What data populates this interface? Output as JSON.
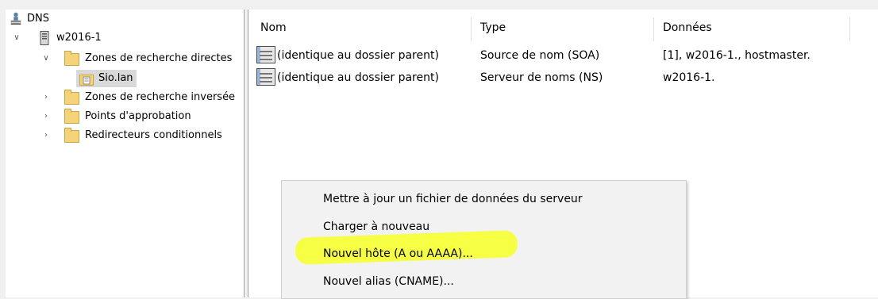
{
  "tree": {
    "root": "DNS",
    "server": "w2016-1",
    "forward_zones": "Zones de recherche directes",
    "zone_selected": "Sio.lan",
    "reverse_zones": "Zones de recherche inversée",
    "trust_points": "Points d'approbation",
    "conditional_forwarders": "Redirecteurs conditionnels"
  },
  "list": {
    "columns": [
      "Nom",
      "Type",
      "Données"
    ],
    "rows": [
      {
        "name": "(identique au dossier parent)",
        "type": "Source de nom (SOA)",
        "data": "[1], w2016-1., hostmaster."
      },
      {
        "name": "(identique au dossier parent)",
        "type": "Serveur de noms (NS)",
        "data": "w2016-1."
      }
    ]
  },
  "context_menu": {
    "items": [
      "Mettre à jour un fichier de données du serveur",
      "Charger à nouveau",
      "Nouvel hôte (A ou AAAA)...",
      "Nouvel alias (CNAME)..."
    ],
    "highlight_color": "#f5ff3a"
  },
  "icons": {
    "dns": "dns-server-icon",
    "server": "server-icon",
    "folder": "folder-icon",
    "zone": "zone-file-icon",
    "record": "record-icon"
  }
}
